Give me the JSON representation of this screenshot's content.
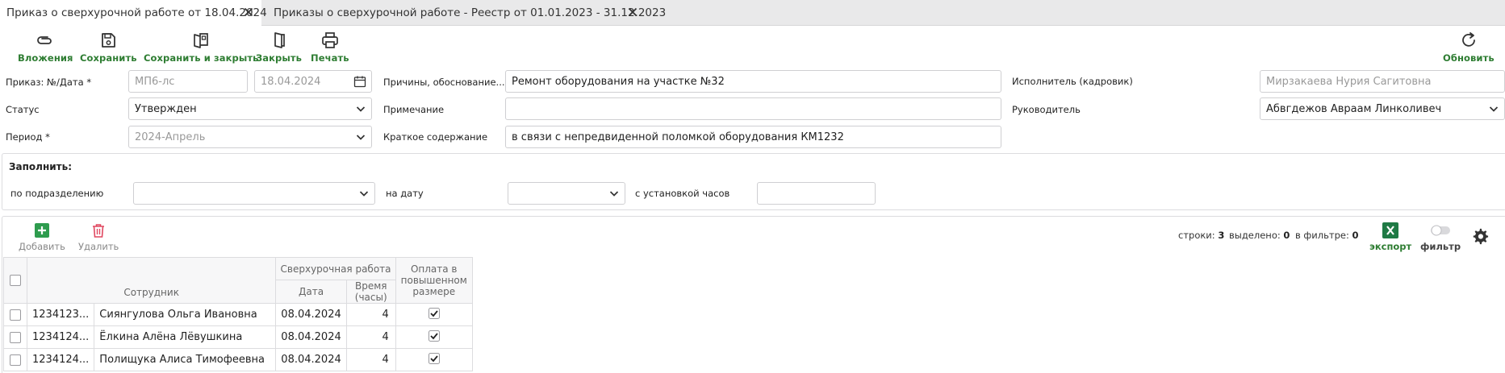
{
  "tabs": [
    {
      "label": "Приказ о сверхурочной работе от 18.04.2024"
    },
    {
      "label": "Приказы о сверхурочной работе - Реестр от 01.01.2023 - 31.12.2023"
    }
  ],
  "toolbar": {
    "attachments": "Вложения",
    "save": "Сохранить",
    "save_close": "Сохранить и закрыть",
    "close": "Закрыть",
    "print": "Печать",
    "refresh": "Обновить"
  },
  "form": {
    "order_label": "Приказ: №/Дата *",
    "order_number_placeholder": "МП6-лс",
    "order_date_placeholder": "18.04.2024",
    "status_label": "Статус",
    "status_value": "Утвержден",
    "period_label": "Период *",
    "period_value": "2024-Апрель",
    "reasons_label": "Причины, обоснование...",
    "reasons_value": "Ремонт оборудования на участке №32",
    "note_label": "Примечание",
    "note_value": "",
    "summary_label": "Краткое содержание",
    "summary_value": "в связи с непредвиденной поломкой оборудования КМ1232",
    "executor_label": "Исполнитель (кадровик)",
    "executor_placeholder": "Мирзакаева Нурия Сагитовна",
    "manager_label": "Руководитель",
    "manager_value": "Абвгдежов Авраам Линколивеч"
  },
  "fill": {
    "title": "Заполнить:",
    "by_department_label": "по подразделению",
    "on_date_label": "на дату",
    "hours_label": "с установкой часов"
  },
  "grid_toolbar": {
    "add": "Добавить",
    "delete": "Удалить",
    "rows_label": "строки:",
    "rows_value": "3",
    "selected_label": "выделено:",
    "selected_value": "0",
    "filtered_label": "в фильтре:",
    "filtered_value": "0",
    "export": "экспорт",
    "filter": "фильтр"
  },
  "table": {
    "headers": {
      "employee": "Сотрудник",
      "overtime_group": "Сверхурочная работа",
      "date": "Дата",
      "hours": "Время (часы)",
      "increased_pay": "Оплата в повышенном размере"
    },
    "rows": [
      {
        "id": "1234123...",
        "name": "Сиянгулова Ольга Ивановна",
        "date": "08.04.2024",
        "hours": "4",
        "paid": true
      },
      {
        "id": "1234124...",
        "name": "Ёлкина Алёна Лёвушкина",
        "date": "08.04.2024",
        "hours": "4",
        "paid": true
      },
      {
        "id": "1234124...",
        "name": "Полищука Алиса Тимофеевна",
        "date": "08.04.2024",
        "hours": "4",
        "paid": true
      }
    ]
  }
}
